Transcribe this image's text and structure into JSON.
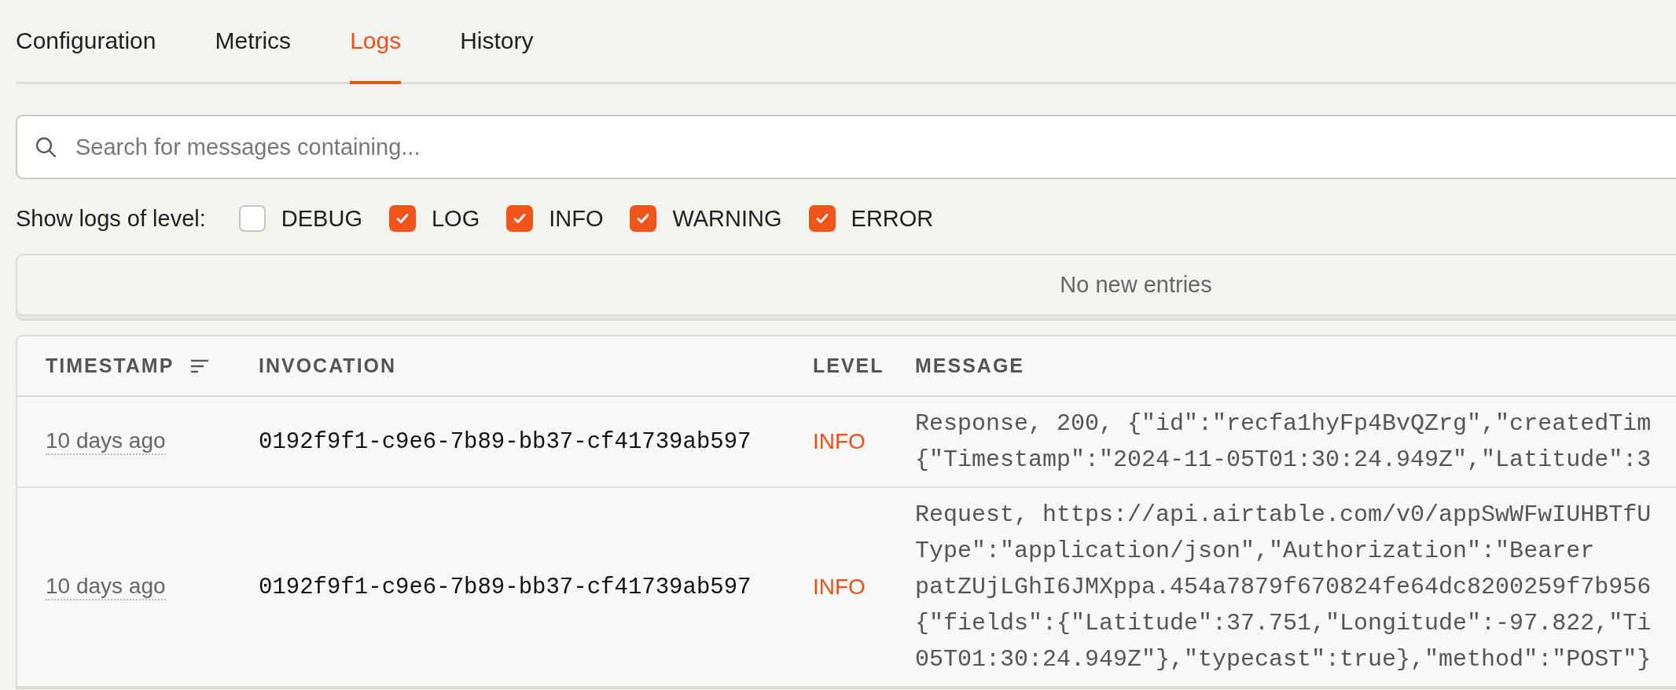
{
  "tabs": [
    {
      "label": "Configuration",
      "selected": false
    },
    {
      "label": "Metrics",
      "selected": false
    },
    {
      "label": "Logs",
      "selected": true
    },
    {
      "label": "History",
      "selected": false
    }
  ],
  "search": {
    "placeholder": "Search for messages containing..."
  },
  "level_filter": {
    "label": "Show logs of level:",
    "levels": [
      {
        "label": "DEBUG",
        "checked": false
      },
      {
        "label": "LOG",
        "checked": true
      },
      {
        "label": "INFO",
        "checked": true
      },
      {
        "label": "WARNING",
        "checked": true
      },
      {
        "label": "ERROR",
        "checked": true
      }
    ]
  },
  "new_entries": {
    "text": "No new entries"
  },
  "table": {
    "columns": [
      {
        "label": "TIMESTAMP",
        "sorted": true
      },
      {
        "label": "INVOCATION",
        "sorted": false
      },
      {
        "label": "LEVEL",
        "sorted": false
      },
      {
        "label": "MESSAGE",
        "sorted": false
      }
    ],
    "rows": [
      {
        "timestamp": "10 days ago",
        "invocation": "0192f9f1-c9e6-7b89-bb37-cf41739ab597",
        "level": "INFO",
        "message": [
          "Response, 200, {\"id\":\"recfa1hyFp4BvQZrg\",\"createdTim",
          "{\"Timestamp\":\"2024-11-05T01:30:24.949Z\",\"Latitude\":3"
        ]
      },
      {
        "timestamp": "10 days ago",
        "invocation": "0192f9f1-c9e6-7b89-bb37-cf41739ab597",
        "level": "INFO",
        "message": [
          "Request, https://api.airtable.com/v0/appSwWFwIUHBTfU",
          "Type\":\"application/json\",\"Authorization\":\"Bearer",
          "patZUjLGhI6JMXppa.454a7879f670824fe64dc8200259f7b956",
          "{\"fields\":{\"Latitude\":37.751,\"Longitude\":-97.822,\"Ti",
          "05T01:30:24.949Z\"},\"typecast\":true},\"method\":\"POST\"}"
        ]
      }
    ]
  }
}
